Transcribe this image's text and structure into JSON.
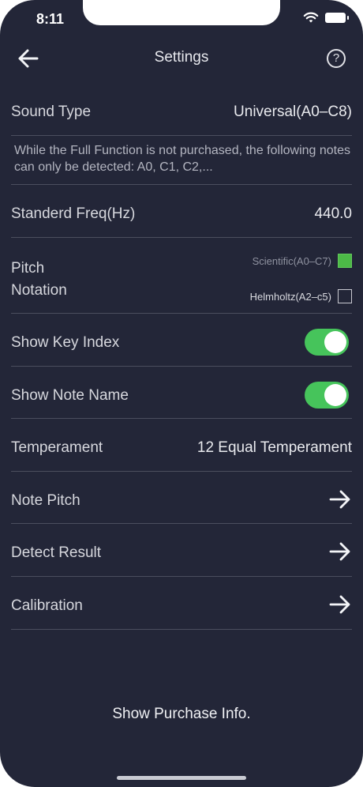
{
  "status": {
    "time": "8:11"
  },
  "nav": {
    "title": "Settings",
    "help": "?"
  },
  "sound_type": {
    "label": "Sound Type",
    "value": "Universal(A0–C8)"
  },
  "notice": "While the Full Function is not purchased, the following notes can only be detected: A0, C1, C2,...",
  "standard_freq": {
    "label": "Standerd Freq(Hz)",
    "value": "440.0"
  },
  "pitch_notation": {
    "label_line1": "Pitch",
    "label_line2": "Notation",
    "options": [
      {
        "label": "Scientific(A0–C7)",
        "checked": true
      },
      {
        "label": "Helmholtz(A2–c5)",
        "checked": false
      }
    ]
  },
  "show_key_index": {
    "label": "Show Key Index",
    "on": true
  },
  "show_note_name": {
    "label": "Show Note Name",
    "on": true
  },
  "temperament": {
    "label": "Temperament",
    "value": "12 Equal Temperament"
  },
  "links": [
    {
      "label": "Note Pitch"
    },
    {
      "label": "Detect Result"
    },
    {
      "label": "Calibration"
    }
  ],
  "purchase_info": "Show Purchase Info.",
  "colors": {
    "background": "#232638",
    "toggle_on": "#46c45b",
    "check_on": "#4cb947"
  }
}
